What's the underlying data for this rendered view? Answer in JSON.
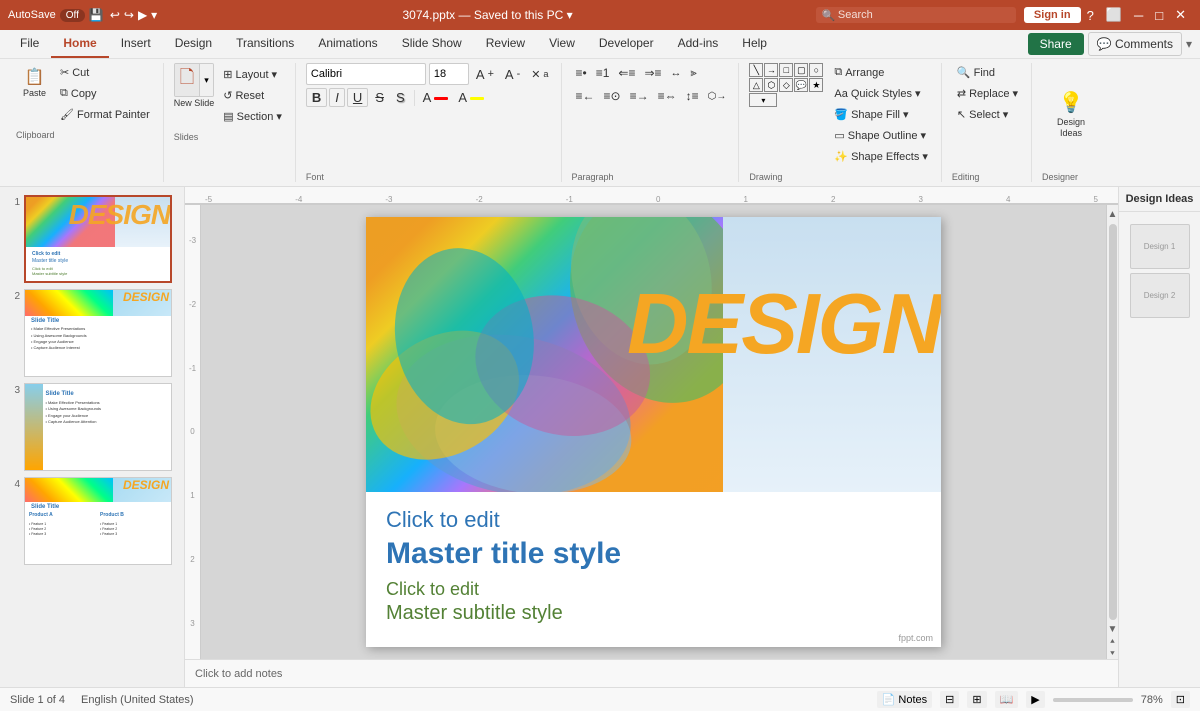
{
  "titlebar": {
    "autosave_label": "AutoSave",
    "autosave_state": "Off",
    "filename": "3074.pptx",
    "saved_state": "Saved to this PC",
    "search_placeholder": "Search",
    "signin_label": "Sign in"
  },
  "ribbon": {
    "tabs": [
      "File",
      "Home",
      "Insert",
      "Design",
      "Transitions",
      "Animations",
      "Slide Show",
      "Review",
      "View",
      "Developer",
      "Add-ins",
      "Help"
    ],
    "active_tab": "Home",
    "share_label": "Share",
    "comments_label": "Comments",
    "groups": {
      "clipboard": {
        "label": "Clipboard",
        "paste_label": "Paste",
        "cut_label": "Cut",
        "copy_label": "Copy",
        "format_painter_label": "Format Painter"
      },
      "slides": {
        "label": "Slides",
        "new_slide_label": "New Slide",
        "layout_label": "Layout",
        "reset_label": "Reset",
        "section_label": "Section"
      },
      "font": {
        "label": "Font",
        "font_name": "Calibri",
        "font_size": "18",
        "bold": "B",
        "italic": "I",
        "underline": "U",
        "strikethrough": "S",
        "shadow": "S",
        "font_color_label": "A",
        "increase_size": "A↑",
        "decrease_size": "A↓",
        "clear_format": "✕"
      },
      "paragraph": {
        "label": "Paragraph"
      },
      "drawing": {
        "label": "Drawing",
        "shape_fill_label": "Shape Fill",
        "shape_outline_label": "Shape Outline",
        "shape_effects_label": "Shape Effects",
        "arrange_label": "Arrange",
        "quick_styles_label": "Quick Styles"
      },
      "editing": {
        "label": "Editing",
        "find_label": "Find",
        "replace_label": "Replace",
        "select_label": "Select"
      },
      "designer": {
        "label": "Designer",
        "design_ideas_label": "Design Ideas"
      }
    }
  },
  "slides": [
    {
      "num": "1",
      "active": true
    },
    {
      "num": "2",
      "active": false
    },
    {
      "num": "3",
      "active": false
    },
    {
      "num": "4",
      "active": false
    }
  ],
  "main_slide": {
    "design_text": "DESIGN",
    "click_edit_title": "Click to edit",
    "master_title": "Master title style",
    "click_edit_subtitle": "Click to edit",
    "master_subtitle": "Master subtitle style",
    "credit": "fppt.com"
  },
  "statusbar": {
    "slide_info": "Slide 1 of 4",
    "language": "English (United States)",
    "notes_label": "Notes",
    "zoom_level": "78%",
    "fit_label": "Fit slide to current window"
  },
  "notes_area": {
    "placeholder": "Click to add notes"
  },
  "design_ideas": {
    "label": "Design Ideas"
  },
  "slide2": {
    "title": "Slide Title",
    "bullets": "• Make Effective Presentations\n• Using Awesome Backgrounds\n• Engage your Audience\n• Capture Audience Interest"
  },
  "slide3": {
    "title": "Slide Title",
    "bullets": "• Make Effective Presentations\n• Using Awesome Backgrounds\n• Engage your Audience\n• Capture Audience Attention"
  },
  "slide4": {
    "title": "Slide Title",
    "product1": "Product A",
    "product2": "Product B",
    "features1": "• Feature 1\n• Feature 2\n• Feature 3",
    "features2": "• Feature 1\n• Feature 2\n• Feature 3"
  }
}
